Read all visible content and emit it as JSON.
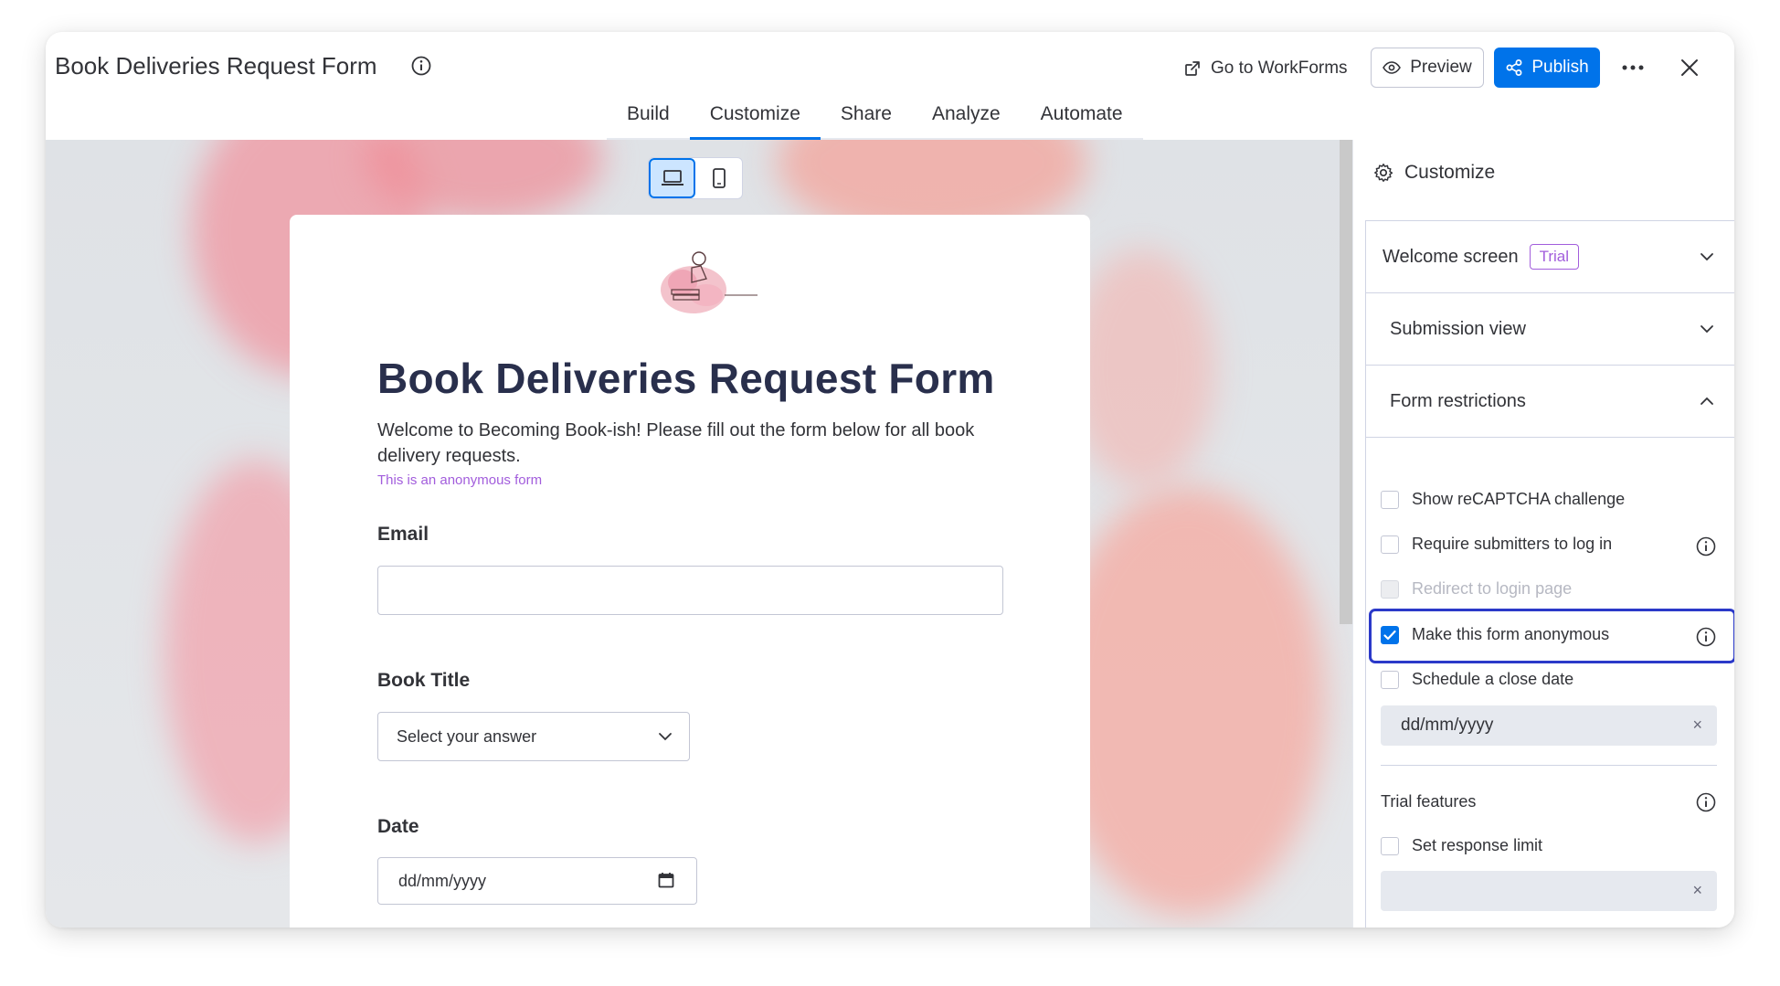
{
  "app": {
    "title": "Book Deliveries Request Form",
    "go_to_workforms": "Go to WorkForms",
    "preview": "Preview",
    "publish": "Publish"
  },
  "tabs": [
    {
      "label": "Build"
    },
    {
      "label": "Customize"
    },
    {
      "label": "Share"
    },
    {
      "label": "Analyze"
    },
    {
      "label": "Automate"
    }
  ],
  "active_tab": "Customize",
  "form": {
    "title": "Book Deliveries Request Form",
    "description": "Welcome to Becoming Book-ish! Please fill out the form below for all book delivery requests.",
    "anonymous_note": "This is an anonymous form",
    "fields": {
      "email": {
        "label": "Email"
      },
      "book_title": {
        "label": "Book Title",
        "placeholder": "Select your answer"
      },
      "date": {
        "label": "Date",
        "placeholder": "dd/mm/yyyy"
      }
    }
  },
  "panel": {
    "title": "Customize",
    "sections": {
      "welcome": {
        "title": "Welcome screen",
        "badge": "Trial"
      },
      "submission": {
        "title": "Submission view"
      },
      "restrictions": {
        "title": "Form restrictions"
      }
    },
    "restrictions": [
      {
        "label": "Show reCAPTCHA challenge",
        "checked": false
      },
      {
        "label": "Require submitters to log in",
        "checked": false
      },
      {
        "label": "Redirect to login page",
        "checked": false,
        "disabled": true
      },
      {
        "label": "Make this form anonymous",
        "checked": true
      },
      {
        "label": "Schedule a close date",
        "checked": false
      }
    ],
    "close_date_placeholder": "dd/mm/yyyy",
    "clear_symbol": "×",
    "trial_features": {
      "title": "Trial features",
      "response_limit": "Set response limit"
    }
  },
  "colors": {
    "primary": "#0073ea",
    "trial": "#a25ddc",
    "highlight": "#2b39c9"
  }
}
